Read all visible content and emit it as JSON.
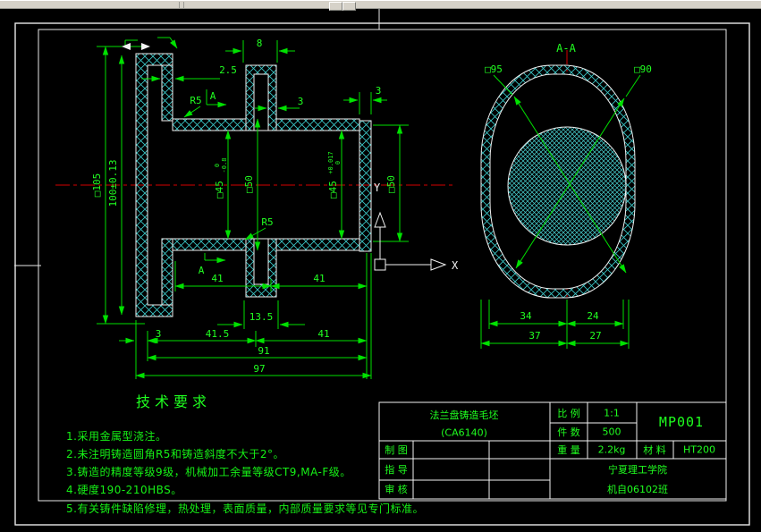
{
  "colors": {
    "background": "#000000",
    "dim_green": "#21ff21",
    "hatch_cyan": "#3ccaca",
    "centerline_red": "#d40000",
    "outline_white": "#f0f0f0",
    "toolbar_gray": "#d6d2c9"
  },
  "left_view": {
    "dims": {
      "d105": "□105",
      "d100": "100±0.13",
      "bore1": "□45",
      "bore1_tol_top": "0",
      "bore1_tol_bot": "-0.8",
      "d50a": "□50",
      "bore2": "□45",
      "bore2_tol_top": "+0.017",
      "bore2_tol_bot": "0",
      "d50b": "□50",
      "d8": "8",
      "d2_5": "2.5",
      "d3_boss": "3",
      "d3_plate": "3",
      "r5_top": "R5",
      "r5_bottom": "R5",
      "sec_a_top": "A",
      "sec_a_bottom": "A",
      "d41a": "41",
      "d41b": "41",
      "d13_5": "13.5",
      "d3_flange": "3",
      "d41_5": "41.5",
      "d41c": "41",
      "d91": "91",
      "d97": "97"
    }
  },
  "right_view": {
    "title": "A-A",
    "d95": "□95",
    "d90": "□90",
    "d34": "34",
    "d24": "24",
    "d37": "37",
    "d27": "27"
  },
  "ucs": {
    "x_label": "X",
    "y_label": "Y"
  },
  "tech": {
    "title": "技术要求",
    "items": [
      "1.采用金属型浇注。",
      "2.未注明铸造圆角R5和铸造斜度不大于2°。",
      "3.铸造的精度等级9级，机械加工余量等级CT9,MA-F级。",
      "4.硬度190-210HBS。",
      "5.有关铸件缺陷修理，热处理，表面质量，内部质量要求等见专门标准。"
    ]
  },
  "title_block": {
    "part_title": "法兰盘铸造毛坯",
    "part_subtitle": "(CA6140)",
    "scale_label": "比 例",
    "scale_value": "1:1",
    "qty_label": "件 数",
    "qty_value": "500",
    "code": "MP001",
    "draw_label": "制 图",
    "weight_label": "重 量",
    "weight_value": "2.2kg",
    "material_label": "材 料",
    "material_value": "HT200",
    "advisor_label": "指 导",
    "checker_label": "审 核",
    "org_line1": "宁夏理工学院",
    "org_line2": "机自06102班"
  }
}
